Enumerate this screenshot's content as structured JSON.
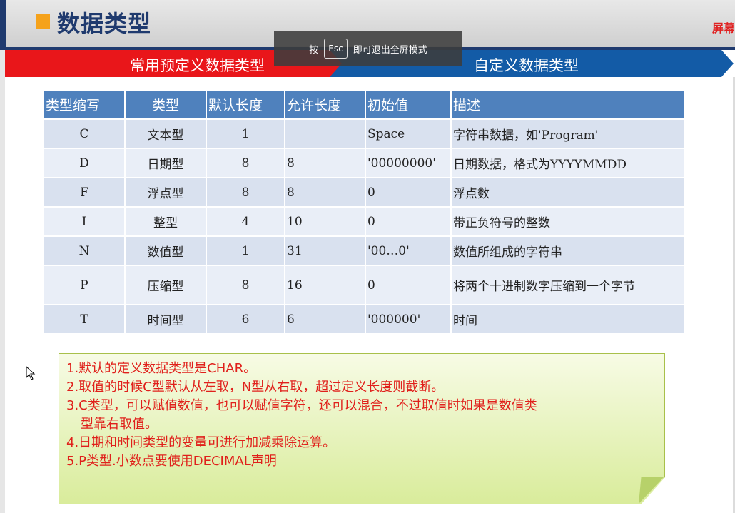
{
  "header": {
    "title": "数据类型",
    "right_label": "屏幕"
  },
  "overlay": {
    "prefix": "按",
    "key": "Esc",
    "suffix": "即可退出全屏模式"
  },
  "banners": {
    "left": "常用预定义数据类型",
    "right": "自定义数据类型"
  },
  "table": {
    "headers": [
      "类型缩写",
      "类型",
      "默认长度",
      "允许长度",
      "初始值",
      "描述"
    ],
    "rows": [
      [
        "C",
        "文本型",
        "1",
        "",
        "Space",
        "字符串数据，如'Program'"
      ],
      [
        "D",
        "日期型",
        "8",
        "8",
        "'00000000'",
        "日期数据，格式为YYYYMMDD"
      ],
      [
        "F",
        "浮点型",
        "8",
        "8",
        "0",
        "浮点数"
      ],
      [
        "I",
        "整型",
        "4",
        "10",
        "0",
        "带正负符号的整数"
      ],
      [
        "N",
        "数值型",
        "1",
        "31",
        "'00…0'",
        "数值所组成的字符串"
      ],
      [
        "P",
        "压缩型",
        "8",
        "16",
        "0",
        "将两个十进制数字压缩到一个字节"
      ],
      [
        "T",
        "时间型",
        "6",
        "6",
        "'000000'",
        "时间"
      ]
    ]
  },
  "notes": [
    "1.默认的定义数据类型是CHAR。",
    "2.取值的时候C型默认从左取，N型从右取，超过定义长度则截断。",
    "3.C类型，可以赋值数值，也可以赋值字符，还可以混合，不过取值时如果是数值类",
    "型靠右取值。",
    "4.日期和时间类型的变量可进行加减乘除运算。",
    "5.P类型.小数点要使用DECIMAL声明"
  ]
}
